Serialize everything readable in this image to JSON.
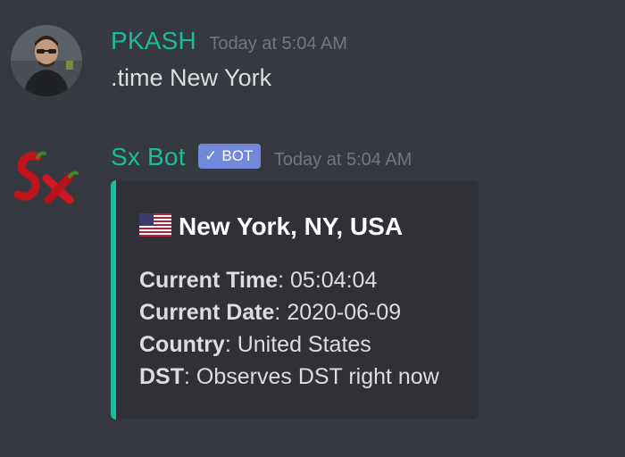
{
  "messages": [
    {
      "username": "PKASH",
      "username_color": "#1abc9c",
      "timestamp": "Today at 5:04 AM",
      "content": ".time New York",
      "avatar_icon": "user-avatar"
    },
    {
      "username": "Sx Bot",
      "username_color": "#1abc9c",
      "bot_tag": "BOT",
      "timestamp": "Today at 5:04 AM",
      "avatar_icon": "chili-sx-logo",
      "embed": {
        "accent_color": "#1abc9c",
        "flag_icon": "us-flag-icon",
        "title": "New York, NY, USA",
        "fields": [
          {
            "label": "Current Time",
            "value": ": 05:04:04"
          },
          {
            "label": "Current Date",
            "value": ": 2020-06-09"
          },
          {
            "label": "Country",
            "value": ": United States"
          },
          {
            "label": "DST",
            "value": ": Observes DST right now"
          }
        ]
      }
    }
  ]
}
